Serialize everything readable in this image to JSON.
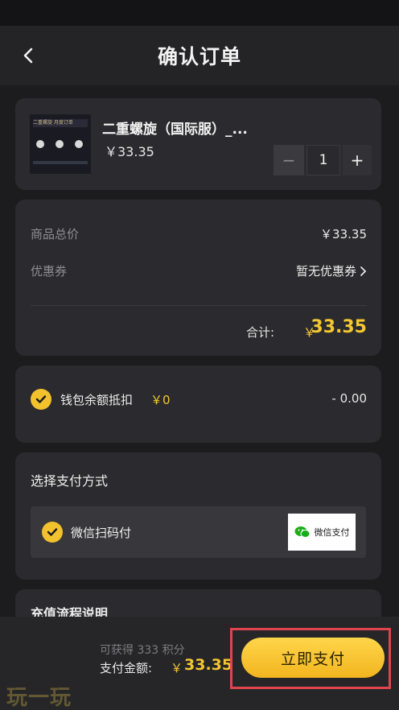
{
  "header": {
    "title": "确认订单",
    "back_icon": "chevron-left-icon"
  },
  "product": {
    "name": "二重螺旋（国际服）_...",
    "price": "￥33.35",
    "quantity": "1",
    "minus": "−",
    "plus": "+",
    "thumbnail_text": "二重螺旋 月度订单"
  },
  "summary": {
    "subtotal_label": "商品总价",
    "subtotal_value": "￥33.35",
    "coupon_label": "优惠券",
    "coupon_value": "暂无优惠券",
    "total_label": "合计:",
    "total_currency": "￥",
    "total_amount": "33.35"
  },
  "wallet": {
    "label": "钱包余额抵扣",
    "balance": "￥0",
    "deduction": "- 0.00"
  },
  "payment": {
    "title": "选择支付方式",
    "option_label": "微信扫码付",
    "badge_text": "微信支付"
  },
  "recharge": {
    "title": "充值流程说明"
  },
  "footer": {
    "points": "可获得 333 积分",
    "pay_label": "支付金额:",
    "pay_currency": "￥",
    "pay_amount": "33.35",
    "pay_button": "立即支付"
  },
  "watermark": "玩一玩",
  "colors": {
    "accent": "#f4c730",
    "highlight_frame": "#e0444c",
    "background": "#17171a",
    "card": "#2b2b2f"
  }
}
